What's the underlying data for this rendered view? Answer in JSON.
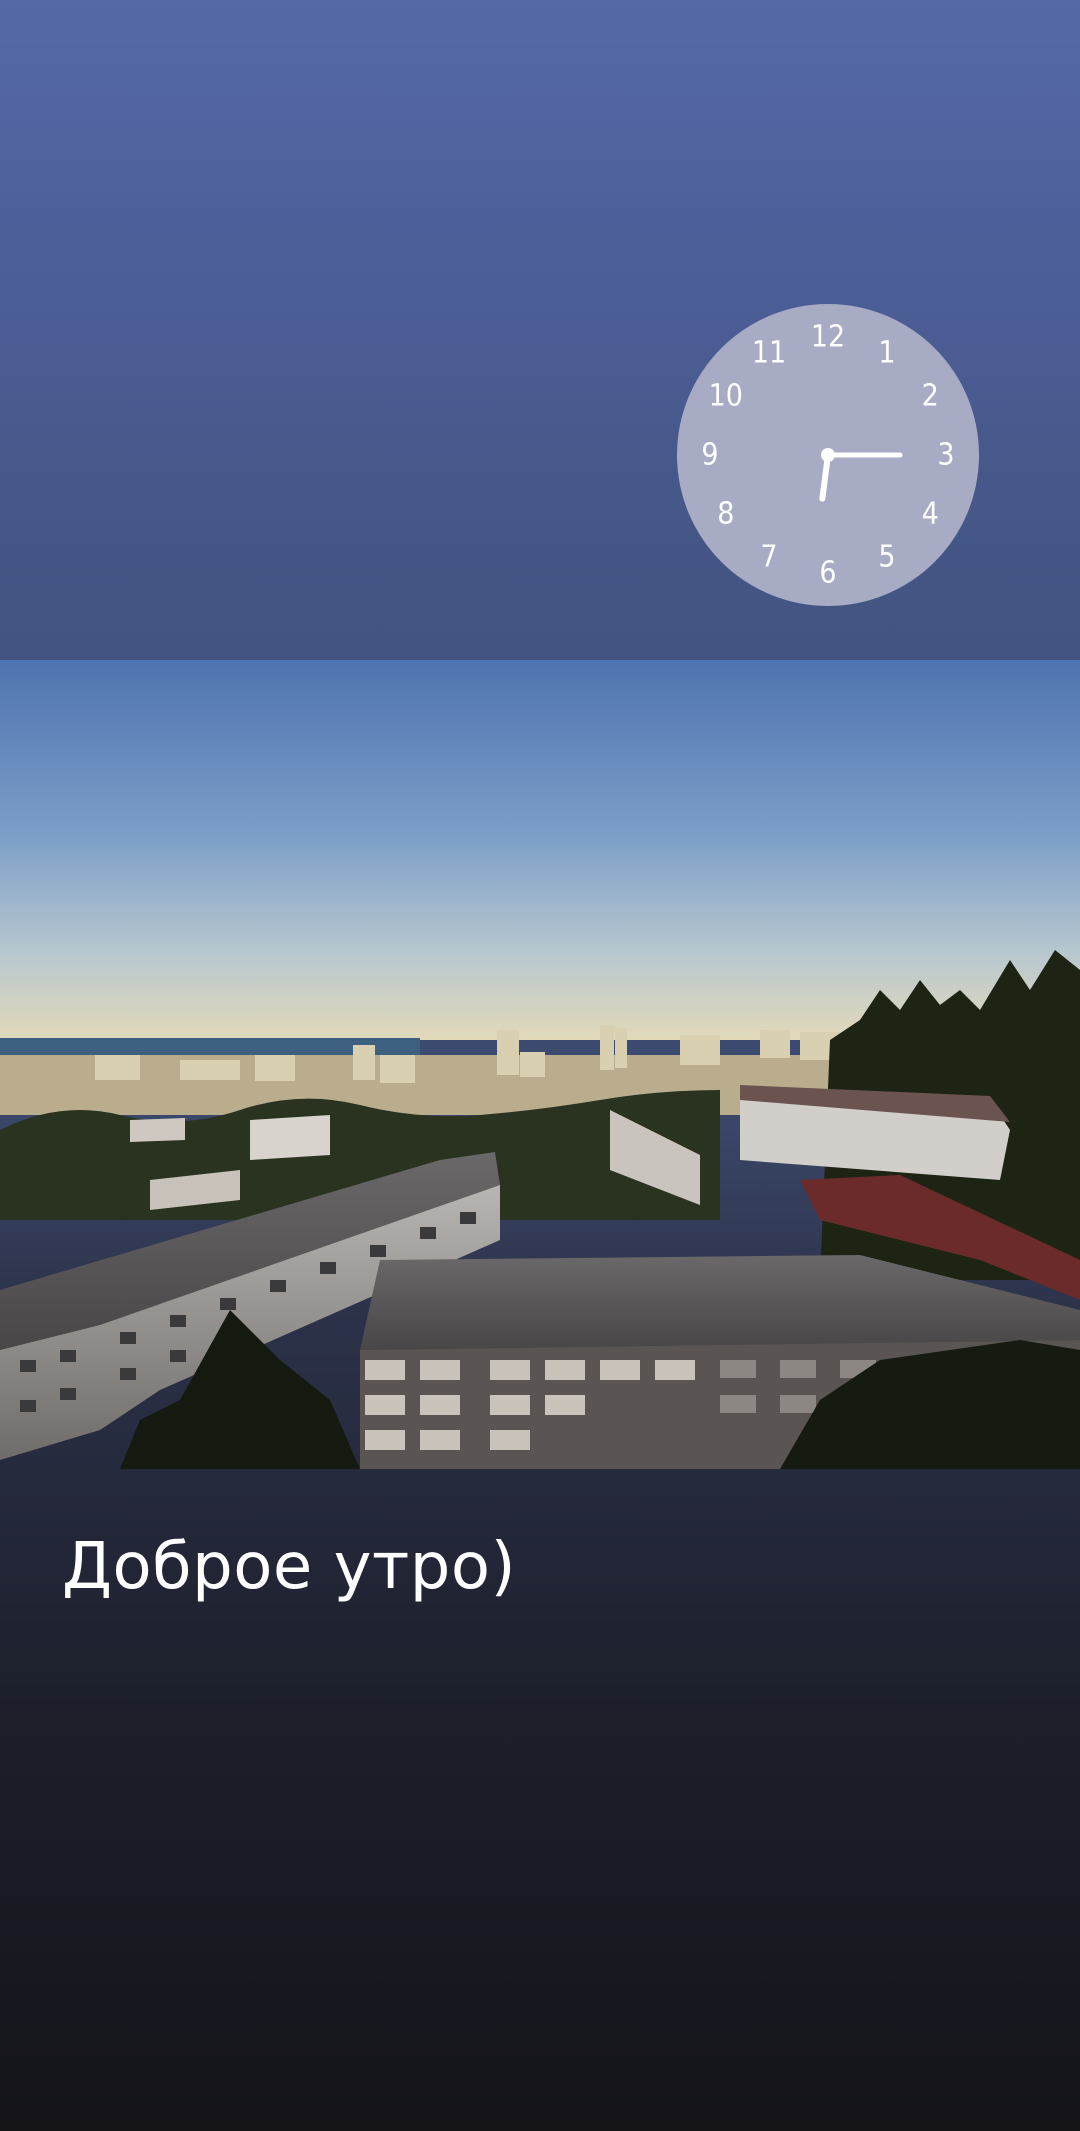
{
  "story": {
    "caption": "Доброе утро)"
  },
  "clock": {
    "numbers": [
      "12",
      "1",
      "2",
      "3",
      "4",
      "5",
      "6",
      "7",
      "8",
      "9",
      "10",
      "11"
    ],
    "time": {
      "hour": 6,
      "minute": 15
    },
    "face_color": "#a7acc4",
    "hand_color": "#ffffff"
  },
  "photo": {
    "icon": "city-panorama-photo",
    "colors": {
      "sky_top": "#4f73b0",
      "sky_horizon": "#e2d9ba",
      "sea": "#3d5f80",
      "foliage": "#1d2414",
      "building_light": "#d2cfcb",
      "roof": "#5d5b5c"
    }
  }
}
